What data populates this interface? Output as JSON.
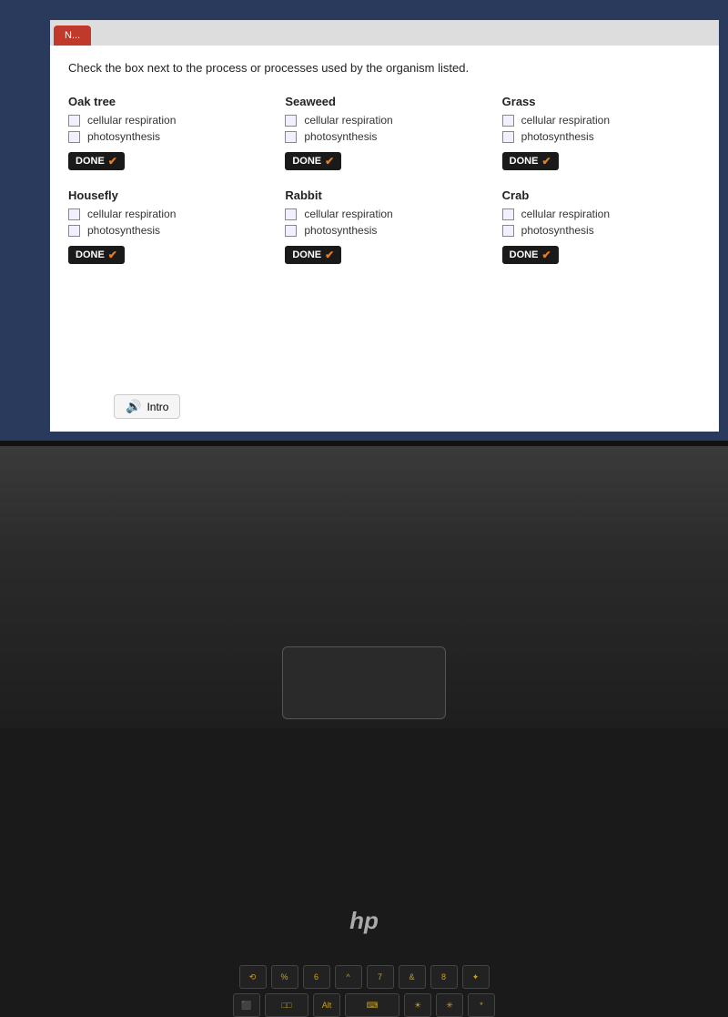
{
  "instruction": "Check the box next to the process or processes used by the organism listed.",
  "organisms": [
    {
      "id": "oak-tree",
      "name": "Oak tree",
      "processes": [
        "cellular respiration",
        "photosynthesis"
      ],
      "showDone": true
    },
    {
      "id": "housefly",
      "name": "Housefly",
      "processes": [
        "cellular respiration",
        "photosynthesis"
      ],
      "showDone": true
    },
    {
      "id": "seaweed",
      "name": "Seaweed",
      "processes": [
        "cellular respiration",
        "photosynthesis"
      ],
      "showDone": true
    },
    {
      "id": "rabbit",
      "name": "Rabbit",
      "processes": [
        "cellular respiration",
        "photosynthesis"
      ],
      "showDone": true
    },
    {
      "id": "grass",
      "name": "Grass",
      "processes": [
        "cellular respiration",
        "photosynthesis"
      ],
      "showDone": true
    },
    {
      "id": "crab",
      "name": "Crab",
      "processes": [
        "cellular respiration",
        "photosynthesis"
      ],
      "showDone": true
    }
  ],
  "doneLabel": "DONE",
  "introLabel": "Intro",
  "tabLabel": "N...",
  "hp_logo": "hp",
  "keys": {
    "row1": [
      "⟲",
      "%",
      "6",
      "^",
      "7",
      "&",
      "8",
      "✦"
    ],
    "row2": [
      "⬛",
      "□□",
      "Alt",
      "⌨",
      "☀",
      "✳",
      "*"
    ]
  }
}
